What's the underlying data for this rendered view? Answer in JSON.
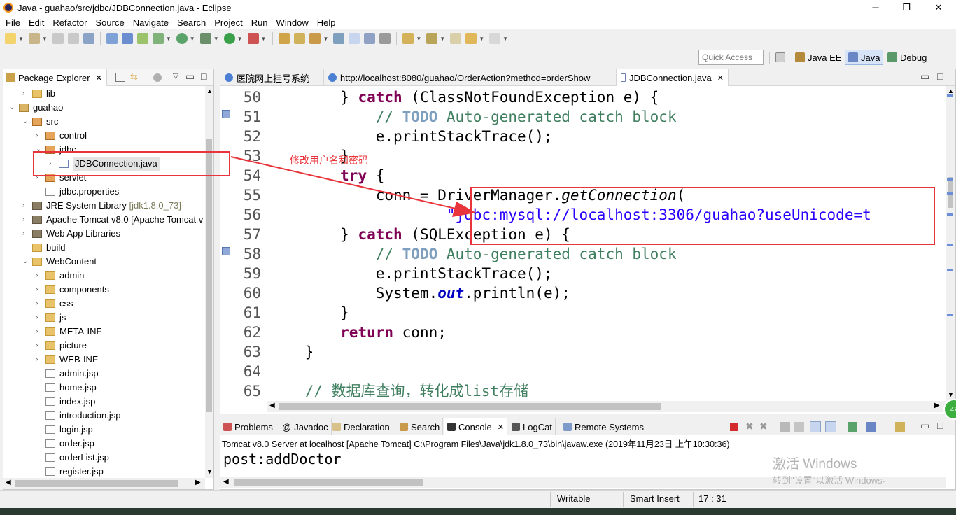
{
  "window": {
    "title": "Java - guahao/src/jdbc/JDBConnection.java - Eclipse",
    "min": "─",
    "max": "❐",
    "close": "✕"
  },
  "menu": [
    "File",
    "Edit",
    "Refactor",
    "Source",
    "Navigate",
    "Search",
    "Project",
    "Run",
    "Window",
    "Help"
  ],
  "toolbar": {
    "quick_access_placeholder": "Quick Access",
    "perspectives": [
      "Java EE",
      "Java",
      "Debug"
    ]
  },
  "explorer": {
    "title": "Package Explorer",
    "tree": [
      {
        "label": "lib",
        "depth": 1,
        "kind": "folder",
        "tri": "›"
      },
      {
        "label": "guahao",
        "depth": 0,
        "kind": "project",
        "tri": "⌄"
      },
      {
        "label": "src",
        "depth": 1,
        "kind": "srcfolder",
        "tri": "⌄"
      },
      {
        "label": "control",
        "depth": 2,
        "kind": "package",
        "tri": "›"
      },
      {
        "label": "jdbc",
        "depth": 2,
        "kind": "package",
        "tri": "⌄"
      },
      {
        "label": "JDBConnection.java",
        "depth": 3,
        "kind": "java",
        "tri": "›"
      },
      {
        "label": "servlet",
        "depth": 2,
        "kind": "package",
        "tri": "›"
      },
      {
        "label": "jdbc.properties",
        "depth": 2,
        "kind": "file",
        "tri": ""
      },
      {
        "label": "JRE System Library",
        "dim": " [jdk1.8.0_73]",
        "depth": 1,
        "kind": "library",
        "tri": "›"
      },
      {
        "label": "Apache Tomcat v8.0 [Apache Tomcat v",
        "depth": 1,
        "kind": "library",
        "tri": "›"
      },
      {
        "label": "Web App Libraries",
        "depth": 1,
        "kind": "library",
        "tri": "›"
      },
      {
        "label": "build",
        "depth": 1,
        "kind": "folder",
        "tri": ""
      },
      {
        "label": "WebContent",
        "depth": 1,
        "kind": "folder",
        "tri": "⌄"
      },
      {
        "label": "admin",
        "depth": 2,
        "kind": "folder",
        "tri": "›"
      },
      {
        "label": "components",
        "depth": 2,
        "kind": "folder",
        "tri": "›"
      },
      {
        "label": "css",
        "depth": 2,
        "kind": "folder",
        "tri": "›"
      },
      {
        "label": "js",
        "depth": 2,
        "kind": "folder",
        "tri": "›"
      },
      {
        "label": "META-INF",
        "depth": 2,
        "kind": "folder",
        "tri": "›"
      },
      {
        "label": "picture",
        "depth": 2,
        "kind": "folder",
        "tri": "›"
      },
      {
        "label": "WEB-INF",
        "depth": 2,
        "kind": "folder",
        "tri": "›"
      },
      {
        "label": "admin.jsp",
        "depth": 2,
        "kind": "jsp",
        "tri": ""
      },
      {
        "label": "home.jsp",
        "depth": 2,
        "kind": "jsp",
        "tri": ""
      },
      {
        "label": "index.jsp",
        "depth": 2,
        "kind": "jsp",
        "tri": ""
      },
      {
        "label": "introduction.jsp",
        "depth": 2,
        "kind": "jsp",
        "tri": ""
      },
      {
        "label": "login.jsp",
        "depth": 2,
        "kind": "jsp",
        "tri": ""
      },
      {
        "label": "order.jsp",
        "depth": 2,
        "kind": "jsp",
        "tri": ""
      },
      {
        "label": "orderList.jsp",
        "depth": 2,
        "kind": "jsp",
        "tri": ""
      },
      {
        "label": "register.jsp",
        "depth": 2,
        "kind": "jsp",
        "tri": ""
      }
    ]
  },
  "editor": {
    "tabs": [
      {
        "label": "医院网上挂号系统",
        "active": false
      },
      {
        "label": "http://localhost:8080/guahao/OrderAction?method=orderShow",
        "active": false
      },
      {
        "label": "JDBConnection.java",
        "active": true
      }
    ],
    "lines": [
      {
        "n": "50",
        "html": "        } <span class=\"kw\">catch</span> (ClassNotFoundException e) {"
      },
      {
        "n": "51",
        "html": "            <span class=\"cm\">// </span><span class=\"todo\">TODO</span><span class=\"cm\"> Auto-generated catch block</span>"
      },
      {
        "n": "52",
        "html": "            e.printStackTrace();"
      },
      {
        "n": "53",
        "html": "        }"
      },
      {
        "n": "54",
        "html": "        <span class=\"kw\">try</span> {"
      },
      {
        "n": "55",
        "html": "            conn = DriverManager.<span class=\"it\">getConnection</span>("
      },
      {
        "n": "56",
        "html": "                    <span class=\"str\">\"jdbc:mysql://localhost:3306/guahao?useUnicode=t</span>"
      },
      {
        "n": "57",
        "html": "        } <span class=\"kw\">catch</span> (SQLException e) {"
      },
      {
        "n": "58",
        "html": "            <span class=\"cm\">// </span><span class=\"todo\">TODO</span><span class=\"cm\"> Auto-generated catch block</span>"
      },
      {
        "n": "59",
        "html": "            e.printStackTrace();"
      },
      {
        "n": "60",
        "html": "            System.<span class=\"fld\">out</span>.println(e);"
      },
      {
        "n": "61",
        "html": "        }"
      },
      {
        "n": "62",
        "html": "        <span class=\"kw\">return</span> conn;"
      },
      {
        "n": "63",
        "html": "    }"
      },
      {
        "n": "64",
        "html": ""
      },
      {
        "n": "65",
        "html": "    <span class=\"cm\">// 数据库查询，转化成list存储</span>"
      }
    ]
  },
  "annotation": {
    "text": "修改用户名和密码",
    "color": "#e8343a"
  },
  "console": {
    "tabs": [
      "Problems",
      "Javadoc",
      "Declaration",
      "Search",
      "Console",
      "LogCat",
      "Remote Systems"
    ],
    "active": "Console",
    "description": "Tomcat v8.0 Server at localhost [Apache Tomcat] C:\\Program Files\\Java\\jdk1.8.0_73\\bin\\javaw.exe (2019年11月23日 上午10:30:36)",
    "output": "post:addDoctor",
    "watermark_title": "激活 Windows",
    "watermark_sub": "转到\"设置\"以激活 Windows。",
    "badge": "47"
  },
  "status": {
    "writable": "Writable",
    "insert_mode": "Smart Insert",
    "position": "17 : 31"
  }
}
